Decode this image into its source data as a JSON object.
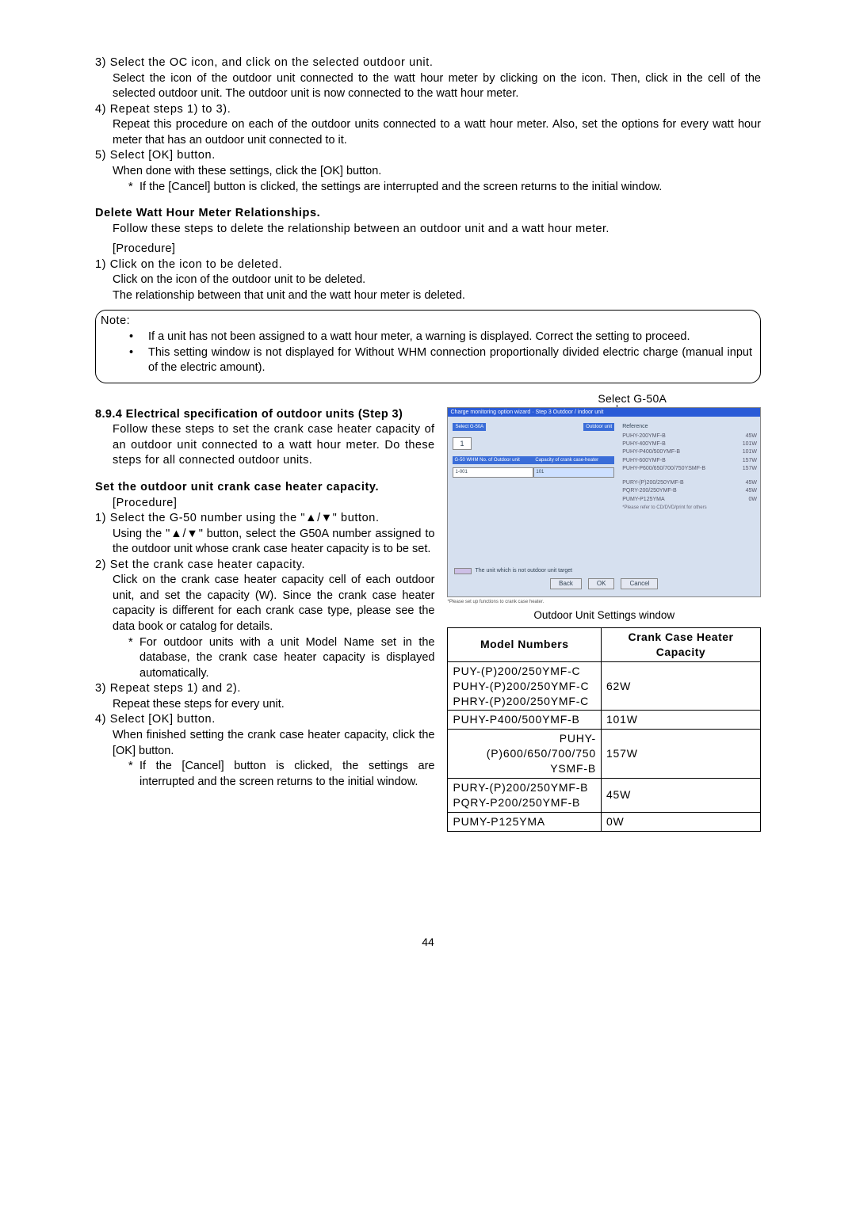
{
  "topSteps": {
    "s3_head": "3) Select the OC icon, and click on the selected outdoor unit.",
    "s3_body": "Select the icon of the outdoor unit connected to the watt hour meter by clicking on the icon. Then, click in the cell of the selected outdoor unit. The outdoor unit is now connected to the watt hour meter.",
    "s4_head": "4) Repeat steps 1) to 3).",
    "s4_body": "Repeat this procedure on each of the outdoor units connected to a watt hour meter. Also, set the options for every watt hour meter that has an outdoor unit connected to it.",
    "s5_head": "5) Select [OK] button.",
    "s5_body": "When done with these settings, click the [OK] button.",
    "s5_star": "If the [Cancel] button is clicked, the settings are interrupted and the screen returns to the initial window."
  },
  "deleteSection": {
    "title": "Delete Watt Hour Meter Relationships.",
    "intro": "Follow these steps to delete the relationship between an outdoor unit and a watt hour meter.",
    "procLabel": "[Procedure]",
    "s1_head": "1) Click on the icon to be deleted.",
    "s1_body1": "Click on the icon of the outdoor unit to be deleted.",
    "s1_body2": "The relationship between that unit and the watt hour meter is deleted."
  },
  "note": {
    "label": "Note:",
    "n1": "If a unit has not been assigned to a watt hour meter, a warning is displayed. Correct the setting to proceed.",
    "n2": "This setting window is not displayed for Without WHM connection proportionally divided electric charge (manual input of the electric amount)."
  },
  "section894": {
    "heading": "8.9.4 Electrical specification of outdoor units (Step 3)",
    "intro": "Follow these steps to set the crank case heater capacity of an outdoor unit connected to a watt hour meter. Do these steps for all connected outdoor units.",
    "subheading": "Set the outdoor unit crank case heater capacity.",
    "procLabel": "[Procedure]",
    "s1_head": "1) Select the G-50 number using the \"▲/▼\" button.",
    "s1_body": "Using the \"▲/▼\" button, select the G50A number assigned to the outdoor unit whose crank case heater capacity is to be set.",
    "s2_head": "2) Set the crank case heater capacity.",
    "s2_body": "Click on the crank case heater capacity cell of each outdoor unit, and set the capacity (W). Since the crank case heater capacity is different for each crank case type, please see the data book or catalog for details.",
    "s2_star": "For outdoor units with a unit Model Name set in the database, the crank case heater capacity is displayed automatically.",
    "s3_head": "3) Repeat steps 1) and 2).",
    "s3_body": "Repeat these steps for every unit.",
    "s4_head": "4) Select [OK] button.",
    "s4_body": "When finished setting the crank case heater capacity, click the [OK] button.",
    "s4_star": "If the [Cancel] button is clicked, the settings are interrupted and the screen returns to the initial window."
  },
  "screenshot": {
    "selectLabel": "Select G-50A",
    "titlebar": "Charge monitoring option wizard · Step 3  Outdoor / indoor unit",
    "chipSelect": "Select G-50A",
    "chipOutdoor": "Outdoor unit",
    "stepperVal": "1",
    "ht1": "G-50 WHM No. of Outdoor unit",
    "ht2": "Capacity of crank case-heater",
    "row1c1": "1-001",
    "row1c2": "101",
    "ref": "Reference",
    "r1": {
      "a": "PUHY-200YMF-B",
      "b": "45W"
    },
    "r2": {
      "a": "PUHY-400YMF-B",
      "b": "101W"
    },
    "r3": {
      "a": "PUHY-P400/500YMF-B",
      "b": "101W"
    },
    "r4": {
      "a": "PUHY-600YMF-B",
      "b": "157W"
    },
    "r5": {
      "a": "PUHY-P600/650/700/750YSMF-B",
      "b": "157W"
    },
    "r6": {
      "a": "PURY-(P)200/250YMF-B",
      "b": "45W"
    },
    "r7": {
      "a": "PQRY-200/250YMF-B",
      "b": "45W"
    },
    "r8": {
      "a": "PUMY-P125YMA",
      "b": "0W"
    },
    "note": "*Please refer to CD/DVD/print for others",
    "footnote": "The unit which is not outdoor unit target",
    "back": "Back",
    "ok": "OK",
    "cancel": "Cancel",
    "bottomTiny": "*Please set up functions to crank case heater.",
    "caption": "Outdoor Unit Settings window"
  },
  "capTable": {
    "h1": "Model Numbers",
    "h2": "Crank Case Heater Capacity",
    "rows": [
      {
        "m": "PUY-(P)200/250YMF-C\nPUHY-(P)200/250YMF-C\nPHRY-(P)200/250YMF-C",
        "c": "62W"
      },
      {
        "m": "PUHY-P400/500YMF-B",
        "c": "101W"
      },
      {
        "m": "PUHY-(P)600/650/700/750\nYSMF-B",
        "c": "157W"
      },
      {
        "m": "PURY-(P)200/250YMF-B\nPQRY-P200/250YMF-B",
        "c": "45W"
      },
      {
        "m": "PUMY-P125YMA",
        "c": "0W"
      }
    ]
  },
  "pageNumber": "44"
}
